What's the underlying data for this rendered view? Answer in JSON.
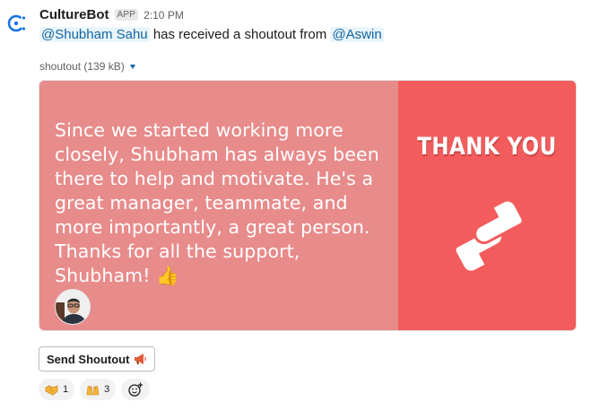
{
  "message": {
    "sender": "CultureBot",
    "badge": "APP",
    "time": "2:10 PM",
    "recipient_mention": "@Shubham Sahu",
    "body_middle": "has received a shoutout from",
    "sender_mention": "@Aswin"
  },
  "attachment": {
    "label": "shoutout (139 kB)",
    "quote": "Since we started working more closely, Shubham has always been there to help and motivate. He's a great manager, teammate, and more importantly, a great person. Thanks for all the support, Shubham! 👍",
    "heading": "THANK YOU",
    "colors": {
      "left": "#e88b8b",
      "right": "#f25c5c"
    }
  },
  "actions": {
    "send_shoutout": "Send Shoutout",
    "send_shoutout_icon": "megaphone-icon"
  },
  "reactions": [
    {
      "icon": "handshake-icon",
      "count": "1"
    },
    {
      "icon": "raised-hands-icon",
      "count": "3"
    }
  ],
  "add_reaction_icon": "add-reaction-icon"
}
